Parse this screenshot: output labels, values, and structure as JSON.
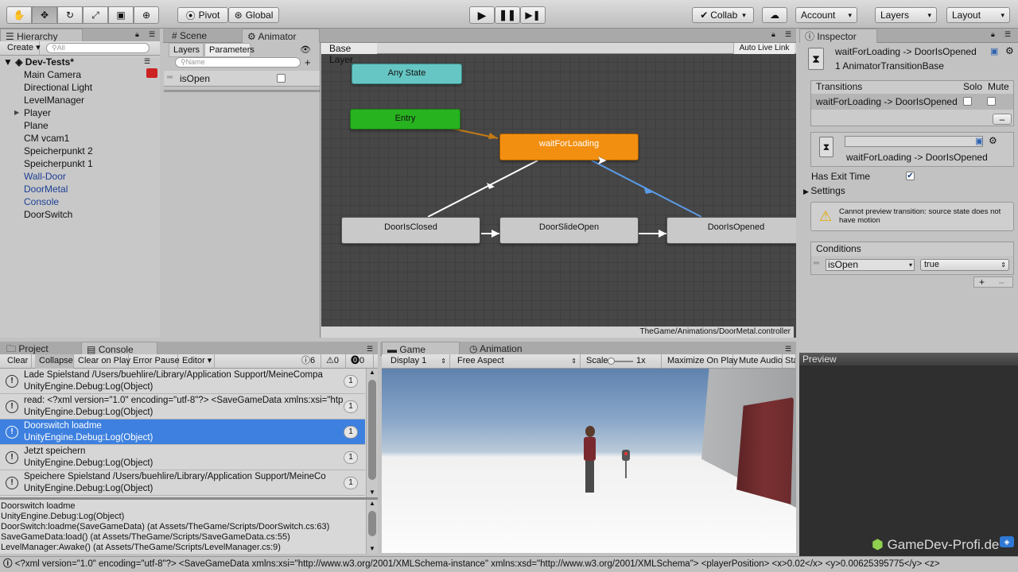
{
  "toolbar": {
    "tools": [
      "hand-tool-icon",
      "move-tool-icon",
      "rotate-tool-icon",
      "scale-tool-icon",
      "rect-tool-icon",
      "transform-tool-icon"
    ],
    "pivot": "Pivot",
    "global": "Global",
    "collab": "Collab",
    "account": "Account",
    "layers": "Layers",
    "layout": "Layout"
  },
  "hierarchy": {
    "tab": "Hierarchy",
    "create": "Create",
    "search_placeholder": "All",
    "scene": "Dev-Tests*",
    "items": [
      {
        "label": "Main Camera",
        "prefab": false
      },
      {
        "label": "Directional Light",
        "prefab": false
      },
      {
        "label": "LevelManager",
        "prefab": false
      },
      {
        "label": "Player",
        "prefab": false,
        "expandable": true
      },
      {
        "label": "Plane",
        "prefab": false
      },
      {
        "label": "CM vcam1",
        "prefab": false
      },
      {
        "label": "Speicherpunkt 2",
        "prefab": false
      },
      {
        "label": "Speicherpunkt 1",
        "prefab": false
      },
      {
        "label": "Wall-Door",
        "prefab": true
      },
      {
        "label": "DoorMetal",
        "prefab": true
      },
      {
        "label": "Console",
        "prefab": true
      },
      {
        "label": "DoorSwitch",
        "prefab": false
      }
    ]
  },
  "scene_tab": "Scene",
  "animator": {
    "tab": "Animator",
    "layers_tab": "Layers",
    "parameters_tab": "Parameters",
    "name_placeholder": "Name",
    "param": "isOpen",
    "breadcrumb": "Base Layer",
    "auto_live_link": "Auto Live Link",
    "path": "TheGame/Animations/DoorMetal.controller",
    "states": {
      "any": "Any State",
      "entry": "Entry",
      "waiting": "waitForLoading",
      "closed": "DoorIsClosed",
      "slide": "DoorSlideOpen",
      "opened": "DoorIsOpened"
    }
  },
  "inspector": {
    "tab": "Inspector",
    "title": "waitForLoading -> DoorIsOpened",
    "subtitle": "1 AnimatorTransitionBase",
    "transitions_header": "Transitions",
    "solo": "Solo",
    "mute": "Mute",
    "transition_row": "waitForLoading -> DoorIsOpened",
    "transition_name": "waitForLoading -> DoorIsOpened",
    "has_exit_time": "Has Exit Time",
    "settings": "Settings",
    "warning": "Cannot preview transition: source state does not have motion",
    "conditions": "Conditions",
    "cond_param": "isOpen",
    "cond_value": "true",
    "preview": "Preview"
  },
  "console": {
    "project_tab": "Project",
    "console_tab": "Console",
    "clear": "Clear",
    "collapse": "Collapse",
    "clear_on_play": "Clear on Play",
    "error_pause": "Error Pause",
    "editor": "Editor",
    "info_count": "6",
    "warn_count": "0",
    "error_count": "0",
    "entries": [
      {
        "line1": "Lade Spielstand /Users/buehlire/Library/Application Support/MeineCompa",
        "line2": "UnityEngine.Debug:Log(Object)",
        "count": "1",
        "selected": false
      },
      {
        "line1": "read: <?xml version=\"1.0\" encoding=\"utf-8\"?> <SaveGameData xmlns:xsi=\"htp",
        "line2": "UnityEngine.Debug:Log(Object)",
        "count": "1",
        "selected": false
      },
      {
        "line1": "Doorswitch loadme",
        "line2": "UnityEngine.Debug:Log(Object)",
        "count": "1",
        "selected": true
      },
      {
        "line1": "Jetzt speichern",
        "line2": "UnityEngine.Debug:Log(Object)",
        "count": "1",
        "selected": false
      },
      {
        "line1": "Speichere Spielstand /Users/buehlire/Library/Application Support/MeineCo",
        "line2": "UnityEngine.Debug:Log(Object)",
        "count": "1",
        "selected": false
      }
    ],
    "detail": [
      "Doorswitch loadme",
      "UnityEngine.Debug:Log(Object)",
      "DoorSwitch:loadme(SaveGameData) (at Assets/TheGame/Scripts/DoorSwitch.cs:63)",
      "SaveGameData:load() (at Assets/TheGame/Scripts/SaveGameData.cs:55)",
      "LevelManager:Awake() (at Assets/TheGame/Scripts/LevelManager.cs:9)"
    ]
  },
  "game": {
    "tab": "Game",
    "animation_tab": "Animation",
    "display": "Display 1",
    "aspect": "Free Aspect",
    "scale_label": "Scale",
    "scale_value": "1x",
    "maximize": "Maximize On Play",
    "mute": "Mute Audio",
    "stats": "Sta"
  },
  "status_bar": "<?xml version=\"1.0\" encoding=\"utf-8\"?> <SaveGameData xmlns:xsi=\"http://www.w3.org/2001/XMLSchema-instance\" xmlns:xsd=\"http://www.w3.org/2001/XMLSchema\"> <playerPosition> <x>0.02</x> <y>0.00625395775</y> <z>",
  "watermark": "GameDev-Profi.de",
  "colors": {
    "selection": "#3d80df",
    "entry": "#27b21f",
    "anystate": "#5fc6c4",
    "active_state": "#f38f10",
    "transition_selected": "#5b9be8"
  }
}
